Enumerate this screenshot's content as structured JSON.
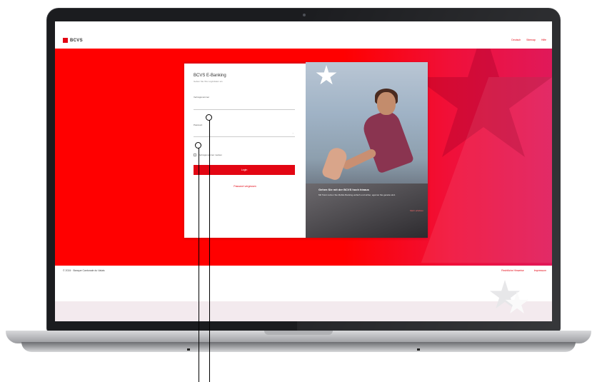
{
  "site": {
    "logo_text": "BCVS",
    "top_links": [
      "Deutsch",
      "Sitemap",
      "Hilfe"
    ]
  },
  "login_form": {
    "title": "BCVS E-Banking",
    "subtitle": "Geben Sie Ihre Logindaten ein",
    "contract_label": "Vertragsnummer",
    "password_label": "Passwort",
    "remember_label": "Vertragsnummer merken",
    "login_button": "Login",
    "forgot_link": "Passwort vergessen"
  },
  "promo": {
    "title": "Gehen Sie mit der BCVS hoch hinaus",
    "text": "Mit Twint nutzen Sie Mobile Banking einfach und sicher, egal wo Sie gerade sind.",
    "link": "Mehr erfahren"
  },
  "footer": {
    "copyright": "© 2024 · Banque Cantonale du Valais",
    "links": [
      "Rechtliche Hinweise",
      "Impressum"
    ]
  },
  "colors": {
    "brand_red": "#e30613",
    "hero_red": "#ff0000"
  },
  "icons": [
    "logo-mark",
    "eye-icon",
    "star-icon"
  ]
}
